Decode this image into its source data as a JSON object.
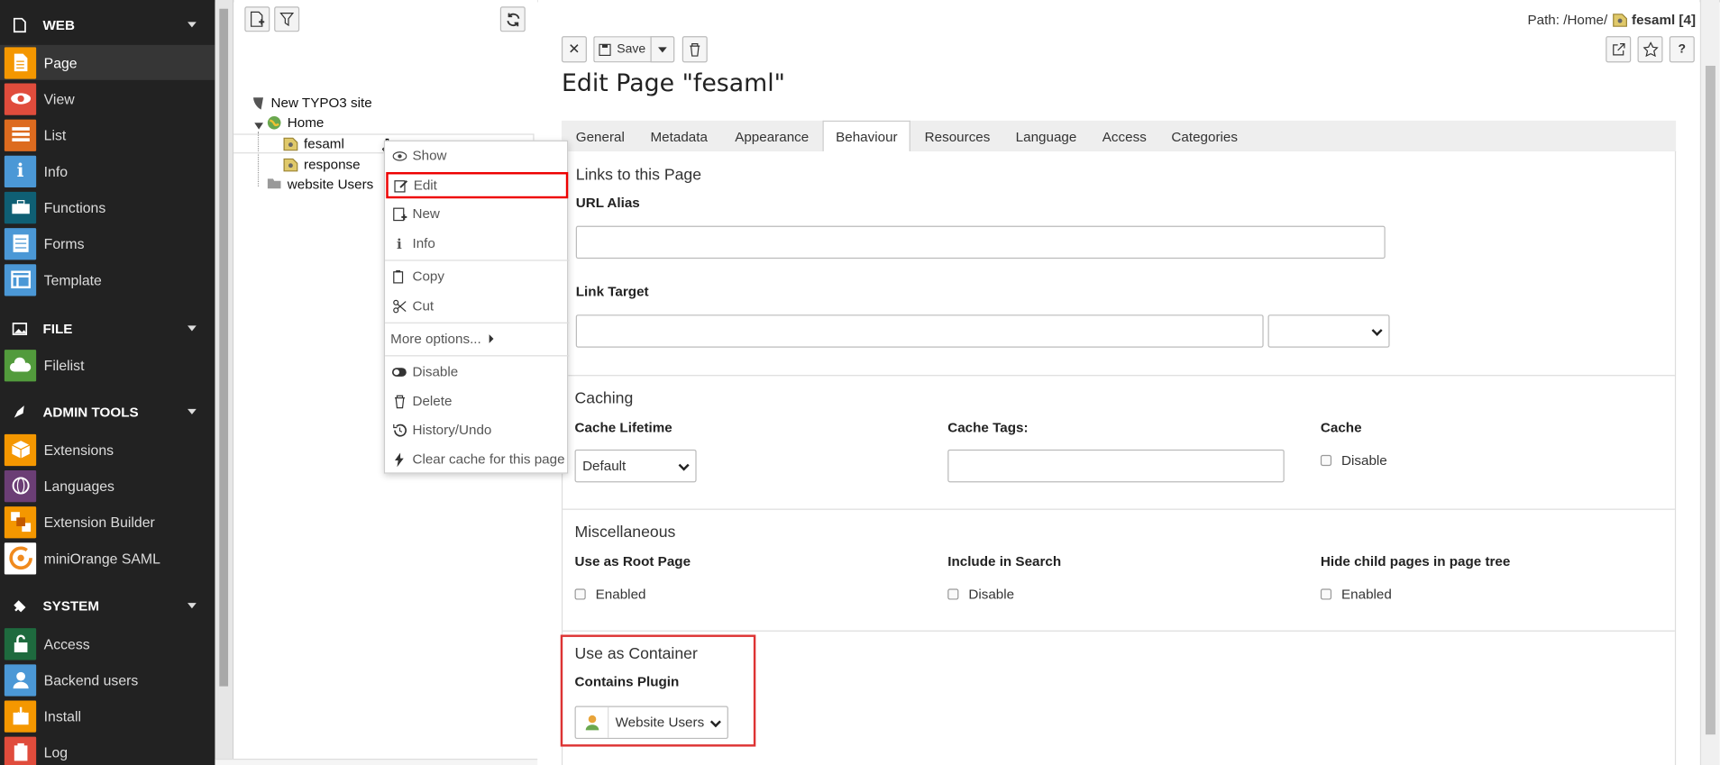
{
  "sidebar": {
    "groups": [
      {
        "label": "WEB",
        "items": [
          "Page",
          "View",
          "List",
          "Info",
          "Functions",
          "Forms",
          "Template"
        ]
      },
      {
        "label": "FILE",
        "items": [
          "Filelist"
        ]
      },
      {
        "label": "ADMIN TOOLS",
        "items": [
          "Extensions",
          "Languages",
          "Extension Builder",
          "miniOrange SAML"
        ]
      },
      {
        "label": "SYSTEM",
        "items": [
          "Access",
          "Backend users",
          "Install",
          "Log"
        ]
      }
    ],
    "active_item": "Page",
    "colors": {
      "page": "#f49700",
      "view": "#e04c3c",
      "list": "#dd6b1f",
      "info": "#4b98d6",
      "functions": "#0f5f74",
      "forms": "#4b98d6",
      "template": "#4b98d6",
      "filelist": "#529b3c",
      "extensions": "#f49700",
      "languages": "#6b3e75",
      "extension_builder": "#f49700",
      "miniorange": "#ffffff",
      "access": "#1e6a3e",
      "backend_users": "#4b98d6",
      "install": "#f49700",
      "log": "#e04c3c"
    }
  },
  "tree": {
    "root": "New TYPO3 site",
    "home": "Home",
    "children": [
      "fesaml",
      "response"
    ],
    "folder": "website Users"
  },
  "context_menu": {
    "items": [
      "Show",
      "Edit",
      "New",
      "Info",
      "Copy",
      "Cut",
      "More options...",
      "Disable",
      "Delete",
      "History/Undo",
      "Clear cache for this page"
    ],
    "selected": "Edit"
  },
  "docheader": {
    "save_label": "Save",
    "path_prefix": "Path: /Home/",
    "path_page": "fesaml [4]"
  },
  "page_title": "Edit Page \"fesaml\"",
  "tabs": [
    "General",
    "Metadata",
    "Appearance",
    "Behaviour",
    "Resources",
    "Language",
    "Access",
    "Categories"
  ],
  "active_tab": "Behaviour",
  "sections": {
    "links": {
      "heading": "Links to this Page",
      "url_alias_label": "URL Alias",
      "url_alias_value": "",
      "link_target_label": "Link Target",
      "link_target_value": "",
      "link_target_select": ""
    },
    "caching": {
      "heading": "Caching",
      "lifetime_label": "Cache Lifetime",
      "lifetime_value": "Default",
      "tags_label": "Cache Tags:",
      "tags_value": "",
      "cache_label": "Cache",
      "cache_option": "Disable"
    },
    "misc": {
      "heading": "Miscellaneous",
      "root_label": "Use as Root Page",
      "root_option": "Enabled",
      "search_label": "Include in Search",
      "search_option": "Disable",
      "hide_label": "Hide child pages in page tree",
      "hide_option": "Enabled"
    },
    "container": {
      "heading": "Use as Container",
      "plugin_label": "Contains Plugin",
      "plugin_value": "Website Users"
    }
  }
}
